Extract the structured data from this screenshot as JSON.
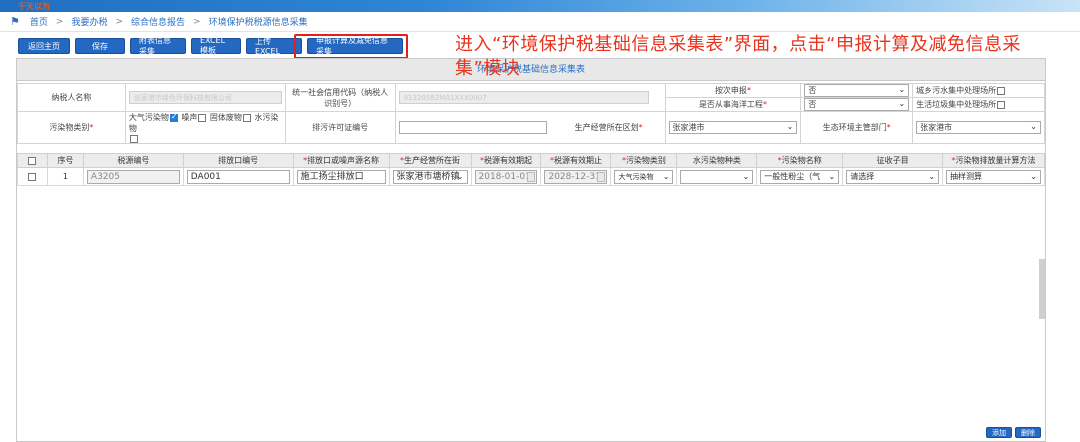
{
  "topbar": {
    "logo_text": "千天以为"
  },
  "breadcrumb": {
    "items": [
      "首页",
      "我要办税",
      "综合信息报告",
      "环境保护税税源信息采集"
    ]
  },
  "toolbar": {
    "buttons": [
      "返回主页",
      "保存",
      "附表信息采集",
      "EXCEL模板",
      "上传EXCEL",
      "申报计算及减免信息采集"
    ]
  },
  "annotation": {
    "text": "进入“环境保护税基础信息采集表”界面，点击“申报计算及减免信息采集”模块"
  },
  "panel": {
    "title": "环境保护税基础信息采集表"
  },
  "info": {
    "taxpayer_name_label": "纳税人名称",
    "taxpayer_name_value": "张家港市绿色环保科技有限公司",
    "credit_code_label_a": "统一社会信用代码（纳税人",
    "credit_code_label_b": "识别号）",
    "credit_code_value": "91320582MA1XXX0007",
    "filing_by_times_label": "按次申报",
    "filing_by_times_value": "否",
    "offshore_label": "是否从事海洋工程",
    "offshore_value": "否",
    "urban_sewage_label": "城乡污水集中处理场所",
    "garbage_label": "生活垃圾集中处理场所",
    "pollutant_type_label": "污染物类别",
    "pollutant_options": [
      "大气污染物",
      "噪声",
      "固体废物",
      "水污染物"
    ],
    "permit_label": "排污许可证编号",
    "admin_district_label": "生产经营所在区划",
    "admin_district_value": "张家港市",
    "eco_dept_label": "生态环境主管部门",
    "eco_dept_value": "张家港市"
  },
  "grid": {
    "headers": [
      "序号",
      "税源编号",
      "排放口编号",
      "排放口或噪声源名称",
      "生产经营所在街",
      "税源有效期起",
      "税源有效期止",
      "污染物类别",
      "水污染物种类",
      "污染物名称",
      "征收子目",
      "污染物排放量计算方法"
    ],
    "required": [
      false,
      false,
      false,
      true,
      true,
      true,
      true,
      true,
      false,
      true,
      false,
      true
    ],
    "rows": [
      {
        "seq": "1",
        "source_no": "A3205",
        "outlet_no": "DA001",
        "outlet_name": "施工扬尘排放口",
        "street": "张家港市塘桥镇",
        "start": "2018-01-01",
        "end": "2028-12-31",
        "pollutant_cat": "大气污染物",
        "water_type": "",
        "pollutant_name": "一般性粉尘（气",
        "sub_item": "请选择",
        "calc_method": "抽样测算"
      }
    ]
  },
  "bottom": {
    "add": "添加",
    "delete": "删除"
  },
  "colors": {
    "primary": "#2568c2",
    "annotation": "#e8331e",
    "highlight_border": "#e02020"
  }
}
